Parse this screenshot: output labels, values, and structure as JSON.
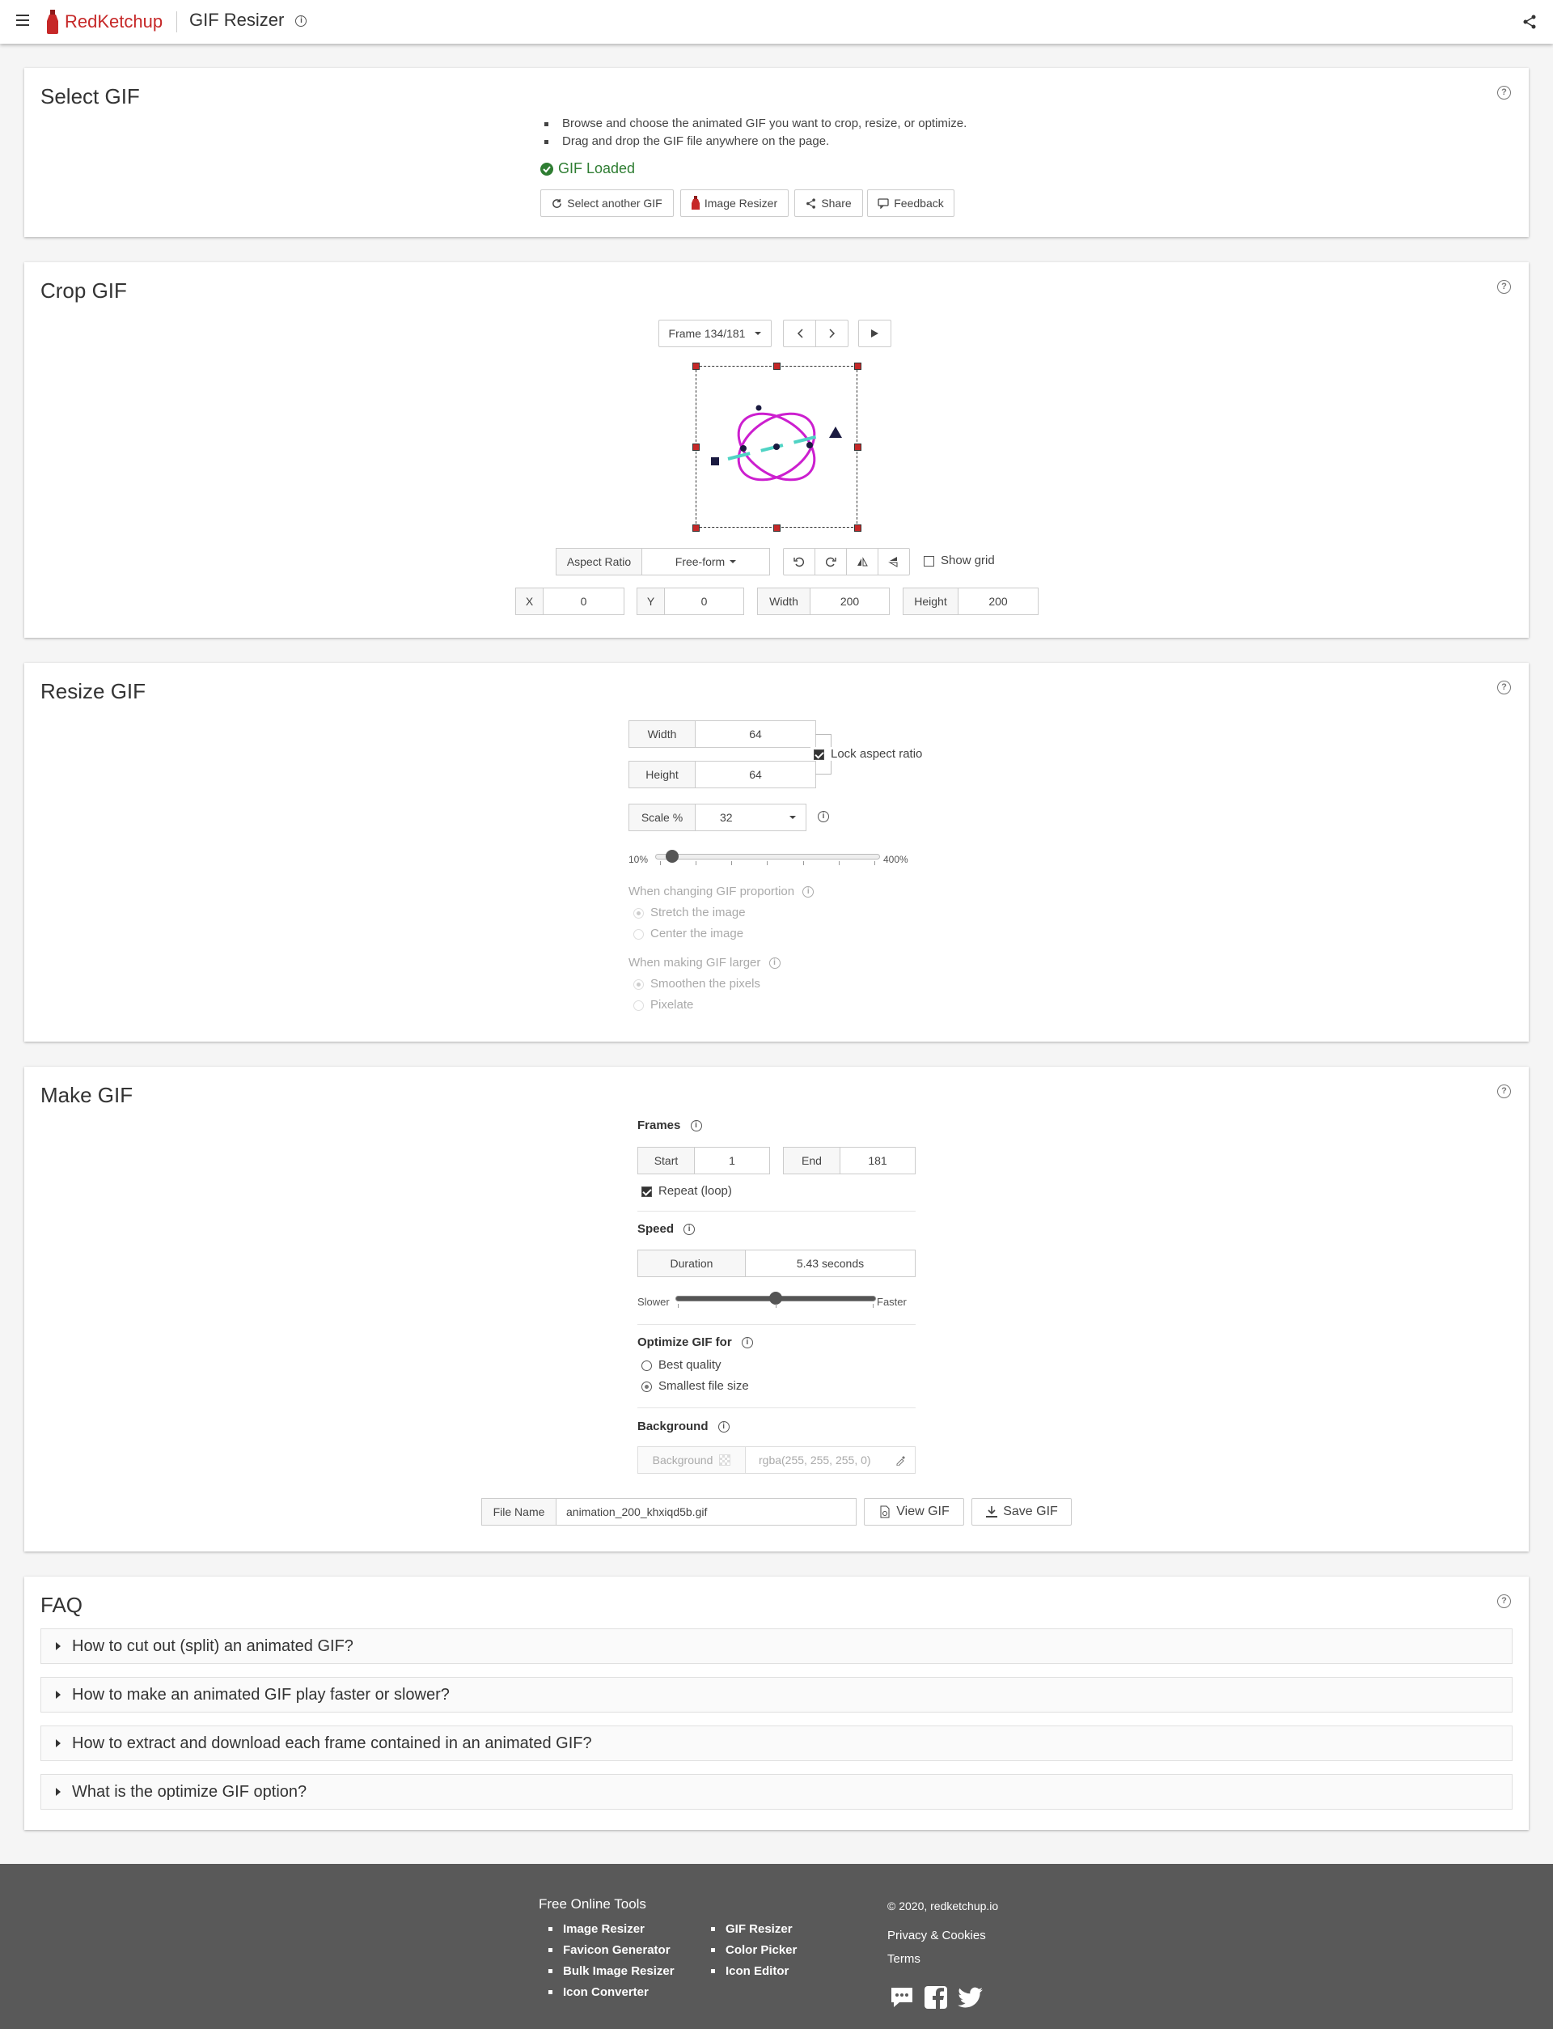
{
  "header": {
    "brand": "RedKetchup",
    "app_title": "GIF Resizer"
  },
  "select_gif": {
    "title": "Select GIF",
    "bullets": [
      "Browse and choose the animated GIF you want to crop, resize, or optimize.",
      "Drag and drop the GIF file anywhere on the page."
    ],
    "status": "GIF Loaded",
    "buttons": {
      "select_another": "Select another GIF",
      "image_resizer": "Image Resizer",
      "share": "Share",
      "feedback": "Feedback"
    }
  },
  "crop_gif": {
    "title": "Crop GIF",
    "frame_label": "Frame 134/181",
    "aspect_ratio_label": "Aspect Ratio",
    "aspect_ratio_value": "Free-form",
    "show_grid_label": "Show grid",
    "fields": {
      "x_label": "X",
      "x_value": "0",
      "y_label": "Y",
      "y_value": "0",
      "width_label": "Width",
      "width_value": "200",
      "height_label": "Height",
      "height_value": "200"
    },
    "colors": {
      "ellipse": "#cc1fcf",
      "line": "#4fd3c4",
      "handle": "#c62828",
      "dots": "#1a1a40"
    }
  },
  "resize_gif": {
    "title": "Resize GIF",
    "width_label": "Width",
    "width_value": "64",
    "height_label": "Height",
    "height_value": "64",
    "lock_label": "Lock aspect ratio",
    "scale_label": "Scale %",
    "scale_value": "32",
    "slider_min": "10%",
    "slider_max": "400%",
    "proportion_label": "When changing GIF proportion",
    "proportion_options": [
      "Stretch the image",
      "Center the image"
    ],
    "larger_label": "When making GIF larger",
    "larger_options": [
      "Smoothen the pixels",
      "Pixelate"
    ]
  },
  "make_gif": {
    "title": "Make GIF",
    "frames_label": "Frames",
    "start_label": "Start",
    "start_value": "1",
    "end_label": "End",
    "end_value": "181",
    "repeat_label": "Repeat (loop)",
    "speed_label": "Speed",
    "duration_label": "Duration",
    "duration_value": "5.43 seconds",
    "slower_label": "Slower",
    "faster_label": "Faster",
    "speed_level": 0.5,
    "optimize_label": "Optimize GIF for",
    "optimize_options": [
      "Best quality",
      "Smallest file size"
    ],
    "background_label": "Background",
    "background_field_label": "Background",
    "background_value": "rgba(255, 255, 255, 0)",
    "file_name_label": "File Name",
    "file_name_value": "animation_200_khxiqd5b.gif",
    "view_button": "View GIF",
    "save_button": "Save GIF"
  },
  "faq": {
    "title": "FAQ",
    "items": [
      "How to cut out (split) an animated GIF?",
      "How to make an animated GIF play faster or slower?",
      "How to extract and download each frame contained in an animated GIF?",
      "What is the optimize GIF option?"
    ]
  },
  "footer": {
    "tools_heading": "Free Online Tools",
    "tools_col1": [
      "Image Resizer",
      "Favicon Generator",
      "Bulk Image Resizer",
      "Icon Converter"
    ],
    "tools_col2": [
      "GIF Resizer",
      "Color Picker",
      "Icon Editor"
    ],
    "copyright": "© 2020, redketchup.io",
    "privacy": "Privacy & Cookies",
    "terms": "Terms"
  },
  "colors": {
    "brand": "#c62828",
    "success": "#2e7d32",
    "footer_bg": "#595959"
  }
}
